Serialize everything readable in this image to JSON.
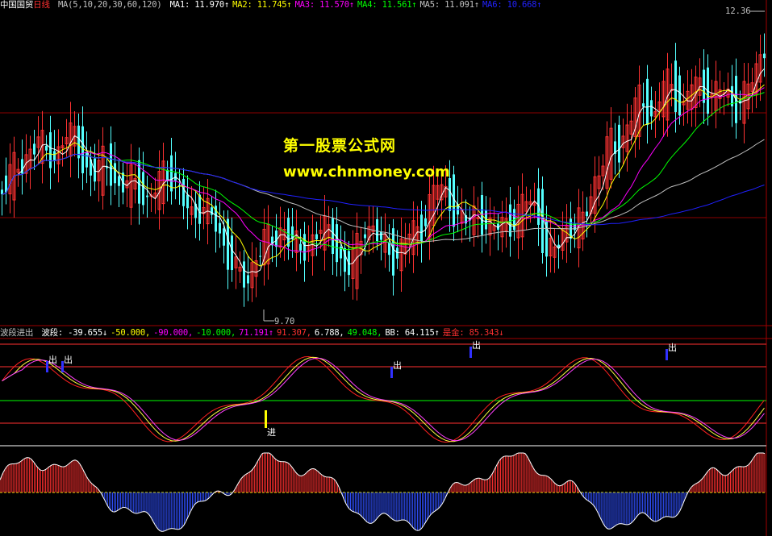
{
  "main_header": {
    "instrument": "中国国贸",
    "period": "日线",
    "ma_def": "MA(5,10,20,30,60,120)",
    "ma_values": [
      {
        "label": "MA1:",
        "value": "11.970",
        "arrow": "↑",
        "color": "#ffffff"
      },
      {
        "label": "MA2:",
        "value": "11.745",
        "arrow": "↑",
        "color": "#ffff00"
      },
      {
        "label": "MA3:",
        "value": "11.570",
        "arrow": "↑",
        "color": "#ff00ff"
      },
      {
        "label": "MA4:",
        "value": "11.561",
        "arrow": "↑",
        "color": "#00ff00"
      },
      {
        "label": "MA5:",
        "value": "11.091",
        "arrow": "↑",
        "color": "#c0c0c0"
      },
      {
        "label": "MA6:",
        "value": "10.668",
        "arrow": "↑",
        "color": "#2222ff"
      }
    ]
  },
  "price_labels": {
    "high": "12.36",
    "low": "9.70"
  },
  "watermark": {
    "line1": "第一股票公式网",
    "line2": "www.chnmoney.com"
  },
  "indicator_header": {
    "name": "波段进出",
    "items": [
      {
        "label": "波段:",
        "value": "-39.655",
        "arrow": "↓",
        "color": "#ffffff"
      },
      {
        "label": "",
        "value": "-50.000,",
        "arrow": "",
        "color": "#ffff00"
      },
      {
        "label": "",
        "value": "-90.000,",
        "arrow": "",
        "color": "#ff00ff"
      },
      {
        "label": "",
        "value": "-10.000,",
        "arrow": "",
        "color": "#00ff00"
      },
      {
        "label": "",
        "value": "71.191",
        "arrow": "↑",
        "color": "#ff00ff"
      },
      {
        "label": "",
        "value": "91.307,",
        "arrow": "",
        "color": "#ff3030"
      },
      {
        "label": "",
        "value": "6.788,",
        "arrow": "",
        "color": "#ffffff"
      },
      {
        "label": "",
        "value": "49.048,",
        "arrow": "",
        "color": "#00ff00"
      },
      {
        "label": "BB:",
        "value": "64.115",
        "arrow": "↑",
        "color": "#ffffff"
      },
      {
        "label": "是金:",
        "value": "85.343",
        "arrow": "↓",
        "color": "#ff3030"
      }
    ]
  },
  "signals": {
    "sell": "出",
    "buy": "进"
  },
  "colors": {
    "up": "#ff3232",
    "down": "#54ffff",
    "grid": "#8b0000",
    "ma1": "#ffffff",
    "ma2": "#ffff00",
    "ma3": "#ff00ff",
    "ma4": "#00ff00",
    "ma5": "#c0c0c0",
    "ma6": "#2020ff"
  },
  "chart_data": {
    "type": "candlestick",
    "price_range": [
      9.7,
      12.36
    ],
    "candle_ohlc_sample": [
      [
        10.75,
        10.95,
        10.6,
        10.85
      ],
      [
        10.85,
        11.2,
        10.8,
        11.05
      ],
      [
        11.05,
        11.25,
        10.95,
        11.0
      ],
      [
        11.0,
        11.3,
        10.9,
        11.2
      ],
      [
        11.2,
        11.45,
        11.1,
        11.35
      ],
      [
        11.35,
        11.4,
        11.05,
        11.1
      ],
      [
        11.1,
        11.25,
        10.95,
        11.15
      ],
      [
        11.15,
        11.45,
        11.1,
        11.4
      ],
      [
        11.4,
        11.55,
        11.25,
        11.3
      ],
      [
        11.3,
        11.35,
        11.0,
        11.05
      ],
      [
        11.05,
        11.15,
        10.85,
        10.95
      ],
      [
        10.95,
        11.2,
        10.9,
        11.1
      ],
      [
        11.1,
        11.25,
        10.95,
        11.0
      ],
      [
        11.0,
        11.1,
        10.75,
        10.8
      ],
      [
        10.8,
        11.0,
        10.7,
        10.95
      ],
      [
        10.95,
        11.05,
        10.8,
        10.85
      ],
      [
        10.85,
        10.95,
        10.6,
        10.7
      ],
      [
        10.7,
        10.9,
        10.55,
        10.85
      ],
      [
        10.85,
        11.1,
        10.8,
        11.05
      ],
      [
        11.05,
        11.15,
        10.85,
        10.9
      ],
      [
        10.9,
        11.0,
        10.65,
        10.7
      ],
      [
        10.7,
        10.8,
        10.45,
        10.55
      ],
      [
        10.55,
        10.75,
        10.5,
        10.7
      ],
      [
        10.7,
        10.85,
        10.55,
        10.6
      ],
      [
        10.6,
        10.7,
        10.3,
        10.35
      ],
      [
        10.35,
        10.5,
        10.1,
        10.2
      ],
      [
        10.2,
        10.3,
        9.95,
        10.05
      ],
      [
        10.05,
        10.2,
        9.7,
        9.9
      ],
      [
        9.9,
        10.3,
        9.85,
        10.25
      ],
      [
        10.25,
        10.45,
        10.15,
        10.4
      ],
      [
        10.4,
        10.5,
        10.2,
        10.3
      ],
      [
        10.3,
        10.55,
        10.25,
        10.5
      ],
      [
        10.5,
        10.6,
        10.3,
        10.35
      ],
      [
        10.35,
        10.45,
        10.1,
        10.2
      ],
      [
        10.2,
        10.4,
        10.15,
        10.35
      ],
      [
        10.35,
        10.55,
        10.3,
        10.5
      ],
      [
        10.5,
        10.6,
        10.35,
        10.4
      ],
      [
        10.4,
        10.5,
        10.15,
        10.2
      ],
      [
        10.2,
        10.3,
        9.95,
        10.05
      ],
      [
        10.05,
        10.3,
        10.0,
        10.25
      ],
      [
        10.25,
        10.55,
        10.2,
        10.5
      ],
      [
        10.5,
        10.65,
        10.4,
        10.45
      ],
      [
        10.45,
        10.55,
        10.25,
        10.3
      ],
      [
        10.3,
        10.4,
        10.1,
        10.15
      ],
      [
        10.15,
        10.35,
        10.05,
        10.3
      ],
      [
        10.3,
        10.5,
        10.25,
        10.45
      ],
      [
        10.45,
        10.6,
        10.35,
        10.4
      ],
      [
        10.4,
        10.75,
        10.35,
        10.7
      ],
      [
        10.7,
        10.95,
        10.65,
        10.9
      ],
      [
        10.9,
        11.0,
        10.7,
        10.75
      ],
      [
        10.75,
        10.85,
        10.55,
        10.6
      ],
      [
        10.6,
        10.7,
        10.4,
        10.5
      ],
      [
        10.5,
        10.65,
        10.45,
        10.6
      ],
      [
        10.6,
        10.75,
        10.5,
        10.55
      ],
      [
        10.55,
        10.65,
        10.35,
        10.4
      ],
      [
        10.4,
        10.6,
        10.35,
        10.55
      ],
      [
        10.55,
        10.7,
        10.45,
        10.5
      ],
      [
        10.5,
        10.65,
        10.4,
        10.6
      ],
      [
        10.6,
        10.9,
        10.55,
        10.8
      ],
      [
        10.8,
        10.85,
        10.55,
        10.6
      ],
      [
        10.6,
        10.7,
        10.1,
        10.15
      ],
      [
        10.15,
        10.35,
        10.0,
        10.3
      ],
      [
        10.3,
        10.55,
        10.25,
        10.5
      ],
      [
        10.5,
        10.65,
        10.4,
        10.45
      ],
      [
        10.45,
        10.6,
        10.4,
        10.55
      ],
      [
        10.55,
        10.9,
        10.5,
        10.85
      ],
      [
        10.85,
        11.1,
        10.8,
        11.05
      ],
      [
        11.05,
        11.35,
        11.0,
        11.3
      ],
      [
        11.3,
        11.45,
        11.15,
        11.2
      ],
      [
        11.2,
        11.5,
        11.15,
        11.45
      ],
      [
        11.45,
        11.8,
        11.4,
        11.7
      ],
      [
        11.7,
        11.95,
        11.55,
        11.6
      ],
      [
        11.6,
        11.75,
        11.4,
        11.5
      ],
      [
        11.5,
        11.95,
        11.45,
        11.9
      ],
      [
        11.9,
        12.05,
        11.7,
        11.75
      ],
      [
        11.75,
        11.85,
        11.45,
        11.55
      ],
      [
        11.55,
        11.9,
        11.5,
        11.85
      ],
      [
        11.85,
        12.1,
        11.75,
        11.8
      ],
      [
        11.8,
        11.9,
        11.55,
        11.65
      ],
      [
        11.65,
        11.85,
        11.6,
        11.8
      ],
      [
        11.8,
        11.95,
        11.65,
        11.7
      ],
      [
        11.7,
        11.85,
        11.55,
        11.6
      ],
      [
        11.6,
        11.8,
        11.5,
        11.75
      ],
      [
        11.75,
        12.0,
        11.7,
        11.95
      ],
      [
        11.95,
        12.36,
        11.9,
        12.2
      ]
    ],
    "ma_series": [
      "MA1",
      "MA2",
      "MA3",
      "MA4",
      "MA5",
      "MA6"
    ],
    "oscillator_range": [
      -100,
      100
    ],
    "oscillator_levels": [
      90,
      50,
      -10,
      -50,
      -90
    ],
    "histogram_baseline": 0
  }
}
